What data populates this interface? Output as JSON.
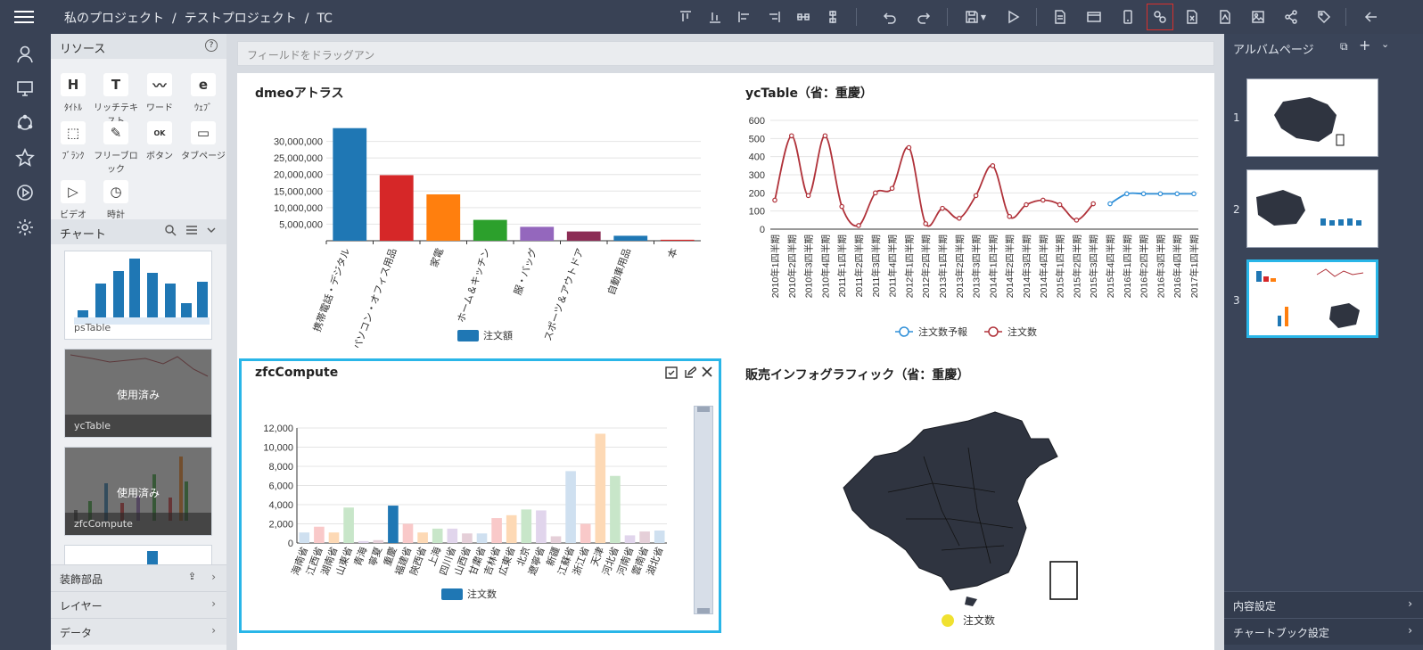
{
  "topbar": {
    "breadcrumb": [
      "私のプロジェクト",
      "テストプロジェクト",
      "TC"
    ],
    "separator": "/",
    "toolbar_icons": [
      "align-top-icon",
      "align-bottom-icon",
      "align-left-icon",
      "align-right-icon",
      "distribute-h-icon",
      "distribute-v-icon",
      "undo-icon",
      "redo-icon",
      "save-icon",
      "preview-icon",
      "document-icon",
      "card-icon",
      "mobile-icon",
      "link-icon",
      "export-excel-icon",
      "export-pdf-icon",
      "export-image-icon",
      "share-icon",
      "tag-icon",
      "back-icon"
    ]
  },
  "sidebar": {
    "icons": [
      "user-icon",
      "monitor-icon",
      "refresh-icon",
      "star-icon",
      "play-icon",
      "settings-icon"
    ]
  },
  "resources": {
    "title": "リソース",
    "items": [
      {
        "glyph": "H",
        "label": "ﾀｲﾄﾙ"
      },
      {
        "glyph": "T",
        "label": "リッチテキスト"
      },
      {
        "glyph": "〰",
        "label": "ワード"
      },
      {
        "glyph": "e",
        "label": "ｳｪﾌﾞ"
      },
      {
        "glyph": "⬚",
        "label": "ﾌﾞﾗﾝｸ"
      },
      {
        "glyph": "✎",
        "label": "フリーブロック"
      },
      {
        "glyph": "OK",
        "label": "ボタン"
      },
      {
        "glyph": "▭",
        "label": "タブページ"
      },
      {
        "glyph": "▷",
        "label": "ビデオ"
      },
      {
        "glyph": "◷",
        "label": "時計"
      }
    ],
    "chart_section": "チャート",
    "thumbs": [
      {
        "label": "psTable",
        "used": false
      },
      {
        "label": "ycTable",
        "used": true
      },
      {
        "label": "zfcCompute",
        "used": true
      }
    ],
    "used_text": "使用済み",
    "sections": [
      "装飾部品",
      "レイヤー",
      "データ"
    ]
  },
  "canvas": {
    "field_placeholder": "フィールドをドラッグアン",
    "charts": {
      "c1_title": "dmeoアトラス",
      "c2_title": "ycTable（省：重慶）",
      "c3_title": "zfcCompute",
      "c4_title": "販売インフォグラフィック（省：重慶）",
      "c4_legend": "注文数"
    }
  },
  "chart_data": [
    {
      "type": "bar",
      "title": "dmeoアトラス",
      "categories": [
        "携帯電話・デジタル",
        "パソコン・オフィス用品",
        "家電",
        "ホーム＆キッチン",
        "服・バッグ",
        "スポーツ＆アウトドア",
        "自動車用品",
        "本"
      ],
      "series": [
        {
          "name": "注文額",
          "values": [
            34000000,
            19800000,
            14000000,
            6300000,
            4200000,
            2800000,
            1500000,
            300000
          ]
        }
      ],
      "ylim": [
        0,
        35000000
      ],
      "yticks": [
        5000000,
        10000000,
        15000000,
        20000000,
        25000000,
        30000000
      ],
      "ytick_labels": [
        "5,000,000",
        "10,000,000",
        "15,000,000",
        "20,000,000",
        "25,000,000",
        "30,000,000"
      ],
      "colors": [
        "#1f77b4",
        "#d62728",
        "#ff7f0e",
        "#2ca02c",
        "#9467bd",
        "#8c2d55",
        "#1f77b4",
        "#d62728"
      ],
      "legend": "bottom"
    },
    {
      "type": "line",
      "title": "ycTable（省：重慶）",
      "categories": [
        "2010年1四半期",
        "2010年2四半期",
        "2010年3四半期",
        "2010年4四半期",
        "2011年1四半期",
        "2011年2四半期",
        "2011年3四半期",
        "2011年4四半期",
        "2012年1四半期",
        "2012年2四半期",
        "2013年1四半期",
        "2013年2四半期",
        "2013年3四半期",
        "2014年1四半期",
        "2014年2四半期",
        "2014年3四半期",
        "2014年4四半期",
        "2015年1四半期",
        "2015年2四半期",
        "2015年3四半期",
        "2015年4四半期",
        "2016年1四半期",
        "2016年2四半期",
        "2016年3四半期",
        "2016年4四半期",
        "2017年1四半期"
      ],
      "series": [
        {
          "name": "注文数予報",
          "color": "#2f8fd8",
          "values": [
            null,
            null,
            null,
            null,
            null,
            null,
            null,
            null,
            null,
            null,
            null,
            null,
            null,
            null,
            null,
            null,
            null,
            null,
            null,
            null,
            140,
            195,
            195,
            195,
            195,
            195
          ]
        },
        {
          "name": "注文数",
          "color": "#b0323a",
          "values": [
            160,
            515,
            185,
            515,
            125,
            20,
            200,
            225,
            450,
            30,
            115,
            60,
            185,
            350,
            70,
            135,
            160,
            135,
            50,
            140,
            null,
            null,
            null,
            null,
            null,
            null
          ]
        }
      ],
      "ylim": [
        0,
        600
      ],
      "yticks": [
        0,
        100,
        200,
        300,
        400,
        500,
        600
      ],
      "legend": "bottom"
    },
    {
      "type": "bar",
      "title": "zfcCompute",
      "categories": [
        "海南省",
        "江西省",
        "湖南省",
        "山東省",
        "青海",
        "寧夏",
        "重慶",
        "福建省",
        "陝西省",
        "上海",
        "四川省",
        "山西省",
        "甘粛省",
        "吉林省",
        "広東省",
        "北京",
        "遼寧省",
        "新疆",
        "江蘇省",
        "浙江省",
        "天津",
        "河北省",
        "河南省",
        "雲南省",
        "湖北省"
      ],
      "series": [
        {
          "name": "注文数",
          "values": [
            1100,
            1700,
            1100,
            3700,
            200,
            300,
            3900,
            2000,
            1100,
            1500,
            1500,
            1000,
            1000,
            2600,
            2900,
            3500,
            3400,
            700,
            7500,
            2000,
            11400,
            7000,
            800,
            1200,
            1300
          ]
        }
      ],
      "highlight": "重慶",
      "ylim": [
        0,
        12000
      ],
      "yticks": [
        0,
        2000,
        4000,
        6000,
        8000,
        10000,
        12000
      ],
      "ytick_labels": [
        "0",
        "2,000",
        "4,000",
        "6,000",
        "8,000",
        "10,000",
        "12,000"
      ],
      "faded_colors": [
        "#cfe0f0",
        "#f9c9c9",
        "#fdd9b5",
        "#c8e6c9",
        "#e1d5ec",
        "#e5cfd8",
        "#1f77b4",
        "#f9c9c9",
        "#fdd9b5",
        "#c8e6c9",
        "#e1d5ec",
        "#e5cfd8",
        "#cfe0f0",
        "#f9c9c9",
        "#fdd9b5",
        "#c8e6c9",
        "#e1d5ec",
        "#e5cfd8",
        "#cfe0f0",
        "#f9c9c9",
        "#fdd9b5",
        "#c8e6c9",
        "#e1d5ec",
        "#e5cfd8",
        "#cfe0f0"
      ],
      "legend": "bottom"
    }
  ],
  "right_panel": {
    "title": "アルバムページ",
    "pages": [
      "1",
      "2",
      "3"
    ],
    "sections": [
      "内容設定",
      "チャートブック設定"
    ]
  }
}
